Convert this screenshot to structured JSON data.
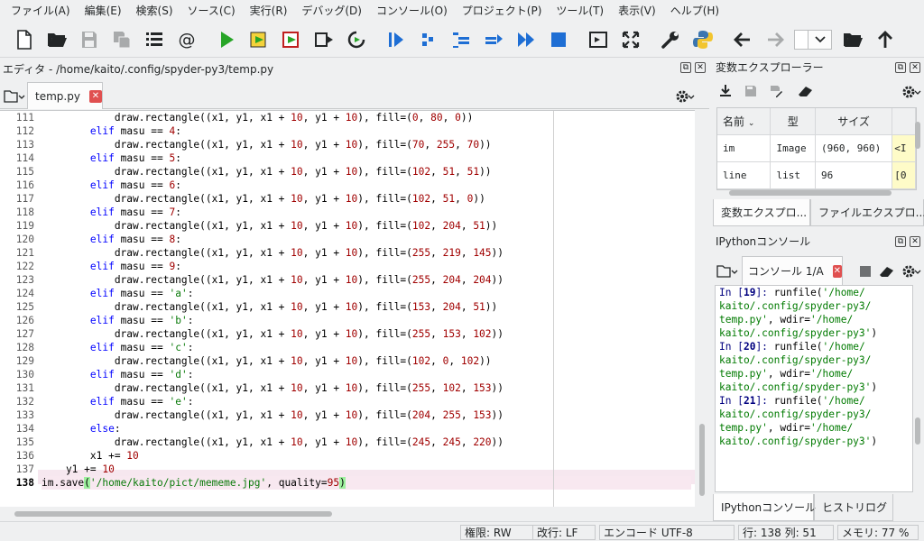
{
  "menubar": {
    "items": [
      "ファイル(A)",
      "編集(E)",
      "検索(S)",
      "ソース(C)",
      "実行(R)",
      "デバッグ(D)",
      "コンソール(O)",
      "プロジェクト(P)",
      "ツール(T)",
      "表示(V)",
      "ヘルプ(H)"
    ]
  },
  "toolbar": {
    "icons": [
      "new-file-icon",
      "open-folder-icon",
      "save-icon",
      "save-all-icon",
      "list-icon",
      "at-icon",
      "run-icon",
      "run-cell-icon",
      "run-cell-advance-icon",
      "run-selection-icon",
      "rerun-icon",
      "debug-icon",
      "step-icon",
      "step-into-icon",
      "step-return-icon",
      "continue-icon",
      "stop-icon",
      "maximize-pane-icon",
      "fullscreen-icon",
      "tools-wrench-icon",
      "python-path-icon",
      "back-arrow-icon",
      "forward-arrow-icon",
      "working-dir-combo",
      "browse-folder-icon",
      "parent-dir-arrow-icon"
    ]
  },
  "editor": {
    "title": "エディタ - /home/kaito/.config/spyder-py3/temp.py",
    "tab_label": "temp.py",
    "tab_close": "✕",
    "lines": [
      {
        "n": "111",
        "segs": [
          {
            "t": "            draw.rectangle((x1, y1, x1 + "
          },
          {
            "t": "10",
            "c": "num"
          },
          {
            "t": ", y1 + "
          },
          {
            "t": "10",
            "c": "num"
          },
          {
            "t": "), fill=("
          },
          {
            "t": "0",
            "c": "num"
          },
          {
            "t": ", "
          },
          {
            "t": "80",
            "c": "num"
          },
          {
            "t": ", "
          },
          {
            "t": "0",
            "c": "num"
          },
          {
            "t": "))"
          }
        ]
      },
      {
        "n": "112",
        "segs": [
          {
            "t": "        "
          },
          {
            "t": "elif",
            "c": "kw"
          },
          {
            "t": " masu == "
          },
          {
            "t": "4",
            "c": "num"
          },
          {
            "t": ":"
          }
        ]
      },
      {
        "n": "113",
        "segs": [
          {
            "t": "            draw.rectangle((x1, y1, x1 + "
          },
          {
            "t": "10",
            "c": "num"
          },
          {
            "t": ", y1 + "
          },
          {
            "t": "10",
            "c": "num"
          },
          {
            "t": "), fill=("
          },
          {
            "t": "70",
            "c": "num"
          },
          {
            "t": ", "
          },
          {
            "t": "255",
            "c": "num"
          },
          {
            "t": ", "
          },
          {
            "t": "70",
            "c": "num"
          },
          {
            "t": "))"
          }
        ]
      },
      {
        "n": "114",
        "segs": [
          {
            "t": "        "
          },
          {
            "t": "elif",
            "c": "kw"
          },
          {
            "t": " masu == "
          },
          {
            "t": "5",
            "c": "num"
          },
          {
            "t": ":"
          }
        ]
      },
      {
        "n": "115",
        "segs": [
          {
            "t": "            draw.rectangle((x1, y1, x1 + "
          },
          {
            "t": "10",
            "c": "num"
          },
          {
            "t": ", y1 + "
          },
          {
            "t": "10",
            "c": "num"
          },
          {
            "t": "), fill=("
          },
          {
            "t": "102",
            "c": "num"
          },
          {
            "t": ", "
          },
          {
            "t": "51",
            "c": "num"
          },
          {
            "t": ", "
          },
          {
            "t": "51",
            "c": "num"
          },
          {
            "t": "))"
          }
        ]
      },
      {
        "n": "116",
        "segs": [
          {
            "t": "        "
          },
          {
            "t": "elif",
            "c": "kw"
          },
          {
            "t": " masu == "
          },
          {
            "t": "6",
            "c": "num"
          },
          {
            "t": ":"
          }
        ]
      },
      {
        "n": "117",
        "segs": [
          {
            "t": "            draw.rectangle((x1, y1, x1 + "
          },
          {
            "t": "10",
            "c": "num"
          },
          {
            "t": ", y1 + "
          },
          {
            "t": "10",
            "c": "num"
          },
          {
            "t": "), fill=("
          },
          {
            "t": "102",
            "c": "num"
          },
          {
            "t": ", "
          },
          {
            "t": "51",
            "c": "num"
          },
          {
            "t": ", "
          },
          {
            "t": "0",
            "c": "num"
          },
          {
            "t": "))"
          }
        ]
      },
      {
        "n": "118",
        "segs": [
          {
            "t": "        "
          },
          {
            "t": "elif",
            "c": "kw"
          },
          {
            "t": " masu == "
          },
          {
            "t": "7",
            "c": "num"
          },
          {
            "t": ":"
          }
        ]
      },
      {
        "n": "119",
        "segs": [
          {
            "t": "            draw.rectangle((x1, y1, x1 + "
          },
          {
            "t": "10",
            "c": "num"
          },
          {
            "t": ", y1 + "
          },
          {
            "t": "10",
            "c": "num"
          },
          {
            "t": "), fill=("
          },
          {
            "t": "102",
            "c": "num"
          },
          {
            "t": ", "
          },
          {
            "t": "204",
            "c": "num"
          },
          {
            "t": ", "
          },
          {
            "t": "51",
            "c": "num"
          },
          {
            "t": "))"
          }
        ]
      },
      {
        "n": "120",
        "segs": [
          {
            "t": "        "
          },
          {
            "t": "elif",
            "c": "kw"
          },
          {
            "t": " masu == "
          },
          {
            "t": "8",
            "c": "num"
          },
          {
            "t": ":"
          }
        ]
      },
      {
        "n": "121",
        "segs": [
          {
            "t": "            draw.rectangle((x1, y1, x1 + "
          },
          {
            "t": "10",
            "c": "num"
          },
          {
            "t": ", y1 + "
          },
          {
            "t": "10",
            "c": "num"
          },
          {
            "t": "), fill=("
          },
          {
            "t": "255",
            "c": "num"
          },
          {
            "t": ", "
          },
          {
            "t": "219",
            "c": "num"
          },
          {
            "t": ", "
          },
          {
            "t": "145",
            "c": "num"
          },
          {
            "t": "))"
          }
        ]
      },
      {
        "n": "122",
        "segs": [
          {
            "t": "        "
          },
          {
            "t": "elif",
            "c": "kw"
          },
          {
            "t": " masu == "
          },
          {
            "t": "9",
            "c": "num"
          },
          {
            "t": ":"
          }
        ]
      },
      {
        "n": "123",
        "segs": [
          {
            "t": "            draw.rectangle((x1, y1, x1 + "
          },
          {
            "t": "10",
            "c": "num"
          },
          {
            "t": ", y1 + "
          },
          {
            "t": "10",
            "c": "num"
          },
          {
            "t": "), fill=("
          },
          {
            "t": "255",
            "c": "num"
          },
          {
            "t": ", "
          },
          {
            "t": "204",
            "c": "num"
          },
          {
            "t": ", "
          },
          {
            "t": "204",
            "c": "num"
          },
          {
            "t": "))"
          }
        ]
      },
      {
        "n": "124",
        "segs": [
          {
            "t": "        "
          },
          {
            "t": "elif",
            "c": "kw"
          },
          {
            "t": " masu == "
          },
          {
            "t": "'a'",
            "c": "str"
          },
          {
            "t": ":"
          }
        ]
      },
      {
        "n": "125",
        "segs": [
          {
            "t": "            draw.rectangle((x1, y1, x1 + "
          },
          {
            "t": "10",
            "c": "num"
          },
          {
            "t": ", y1 + "
          },
          {
            "t": "10",
            "c": "num"
          },
          {
            "t": "), fill=("
          },
          {
            "t": "153",
            "c": "num"
          },
          {
            "t": ", "
          },
          {
            "t": "204",
            "c": "num"
          },
          {
            "t": ", "
          },
          {
            "t": "51",
            "c": "num"
          },
          {
            "t": "))"
          }
        ]
      },
      {
        "n": "126",
        "segs": [
          {
            "t": "        "
          },
          {
            "t": "elif",
            "c": "kw"
          },
          {
            "t": " masu == "
          },
          {
            "t": "'b'",
            "c": "str"
          },
          {
            "t": ":"
          }
        ]
      },
      {
        "n": "127",
        "segs": [
          {
            "t": "            draw.rectangle((x1, y1, x1 + "
          },
          {
            "t": "10",
            "c": "num"
          },
          {
            "t": ", y1 + "
          },
          {
            "t": "10",
            "c": "num"
          },
          {
            "t": "), fill=("
          },
          {
            "t": "255",
            "c": "num"
          },
          {
            "t": ", "
          },
          {
            "t": "153",
            "c": "num"
          },
          {
            "t": ", "
          },
          {
            "t": "102",
            "c": "num"
          },
          {
            "t": "))"
          }
        ]
      },
      {
        "n": "128",
        "segs": [
          {
            "t": "        "
          },
          {
            "t": "elif",
            "c": "kw"
          },
          {
            "t": " masu == "
          },
          {
            "t": "'c'",
            "c": "str"
          },
          {
            "t": ":"
          }
        ]
      },
      {
        "n": "129",
        "segs": [
          {
            "t": "            draw.rectangle((x1, y1, x1 + "
          },
          {
            "t": "10",
            "c": "num"
          },
          {
            "t": ", y1 + "
          },
          {
            "t": "10",
            "c": "num"
          },
          {
            "t": "), fill=("
          },
          {
            "t": "102",
            "c": "num"
          },
          {
            "t": ", "
          },
          {
            "t": "0",
            "c": "num"
          },
          {
            "t": ", "
          },
          {
            "t": "102",
            "c": "num"
          },
          {
            "t": "))"
          }
        ]
      },
      {
        "n": "130",
        "segs": [
          {
            "t": "        "
          },
          {
            "t": "elif",
            "c": "kw"
          },
          {
            "t": " masu == "
          },
          {
            "t": "'d'",
            "c": "str"
          },
          {
            "t": ":"
          }
        ]
      },
      {
        "n": "131",
        "segs": [
          {
            "t": "            draw.rectangle((x1, y1, x1 + "
          },
          {
            "t": "10",
            "c": "num"
          },
          {
            "t": ", y1 + "
          },
          {
            "t": "10",
            "c": "num"
          },
          {
            "t": "), fill=("
          },
          {
            "t": "255",
            "c": "num"
          },
          {
            "t": ", "
          },
          {
            "t": "102",
            "c": "num"
          },
          {
            "t": ", "
          },
          {
            "t": "153",
            "c": "num"
          },
          {
            "t": "))"
          }
        ]
      },
      {
        "n": "132",
        "segs": [
          {
            "t": "        "
          },
          {
            "t": "elif",
            "c": "kw"
          },
          {
            "t": " masu == "
          },
          {
            "t": "'e'",
            "c": "str"
          },
          {
            "t": ":"
          }
        ]
      },
      {
        "n": "133",
        "segs": [
          {
            "t": "            draw.rectangle((x1, y1, x1 + "
          },
          {
            "t": "10",
            "c": "num"
          },
          {
            "t": ", y1 + "
          },
          {
            "t": "10",
            "c": "num"
          },
          {
            "t": "), fill=("
          },
          {
            "t": "204",
            "c": "num"
          },
          {
            "t": ", "
          },
          {
            "t": "255",
            "c": "num"
          },
          {
            "t": ", "
          },
          {
            "t": "153",
            "c": "num"
          },
          {
            "t": "))"
          }
        ]
      },
      {
        "n": "134",
        "segs": [
          {
            "t": "        "
          },
          {
            "t": "else",
            "c": "kw"
          },
          {
            "t": ":"
          }
        ]
      },
      {
        "n": "135",
        "segs": [
          {
            "t": "            draw.rectangle((x1, y1, x1 + "
          },
          {
            "t": "10",
            "c": "num"
          },
          {
            "t": ", y1 + "
          },
          {
            "t": "10",
            "c": "num"
          },
          {
            "t": "), fill=("
          },
          {
            "t": "245",
            "c": "num"
          },
          {
            "t": ", "
          },
          {
            "t": "245",
            "c": "num"
          },
          {
            "t": ", "
          },
          {
            "t": "220",
            "c": "num"
          },
          {
            "t": "))"
          }
        ]
      },
      {
        "n": "136",
        "segs": [
          {
            "t": "        x1 += "
          },
          {
            "t": "10",
            "c": "num"
          }
        ]
      },
      {
        "n": "137",
        "segs": [
          {
            "t": "    y1 += "
          },
          {
            "t": "10",
            "c": "num"
          }
        ]
      },
      {
        "n": "138",
        "current": true,
        "segs": [
          {
            "t": "im.save"
          },
          {
            "t": "(",
            "c": "brace"
          },
          {
            "t": "'/home/kaito/pict/mememe.jpg'",
            "c": "str"
          },
          {
            "t": ", quality="
          },
          {
            "t": "95",
            "c": "num"
          },
          {
            "t": ")",
            "c": "brace"
          }
        ]
      }
    ]
  },
  "variable_explorer": {
    "title": "変数エクスプローラー",
    "columns": [
      "名前",
      "型",
      "サイズ",
      ""
    ],
    "rows": [
      {
        "name": "im",
        "type": "Image",
        "size": "(960, 960)",
        "value": "<I"
      },
      {
        "name": "line",
        "type": "list",
        "size": "96",
        "value": "[0"
      }
    ],
    "tabs": [
      "変数エクスプロ...",
      "ファイルエクスプロ..."
    ]
  },
  "ipython": {
    "title": "IPythonコンソール",
    "tab_label": "コンソール 1/A",
    "tab_close": "✕",
    "lines": [
      {
        "t": "",
        "kind": "blank"
      },
      {
        "t": "In [19]: runfile('/home/",
        "kind": "in",
        "num": "19",
        "rest": "runfile(",
        "s": "'/home/"
      },
      {
        "t": "kaito/.config/spyder-py3/",
        "kind": "cont"
      },
      {
        "t": "temp.py', wdir='/home/",
        "kind": "cont"
      },
      {
        "t": "kaito/.config/spyder-py3')",
        "kind": "cont"
      },
      {
        "t": "",
        "kind": "blank"
      },
      {
        "t": "In [20]: runfile('/home/",
        "kind": "in",
        "num": "20",
        "rest": "runfile(",
        "s": "'/home/"
      },
      {
        "t": "kaito/.config/spyder-py3/",
        "kind": "cont"
      },
      {
        "t": "temp.py', wdir='/home/",
        "kind": "cont"
      },
      {
        "t": "kaito/.config/spyder-py3')",
        "kind": "cont"
      },
      {
        "t": "",
        "kind": "blank"
      },
      {
        "t": "In [21]: runfile('/home/",
        "kind": "in",
        "num": "21",
        "rest": "runfile(",
        "s": "'/home/"
      },
      {
        "t": "kaito/.config/spyder-py3/",
        "kind": "cont"
      },
      {
        "t": "temp.py', wdir='/home/",
        "kind": "cont"
      },
      {
        "t": "kaito/.config/spyder-py3')",
        "kind": "cont"
      }
    ],
    "tabs": [
      "IPythonコンソール",
      "ヒストリログ"
    ]
  },
  "statusbar": {
    "permissions": "権限: RW",
    "eol": "改行: LF",
    "encoding": "エンコード  UTF-8",
    "cursor": "行: 138   列: 51",
    "memory": "メモリ: 77 %"
  },
  "colors": {
    "keyword": "#0000ff",
    "number": "#a00000",
    "string": "#0a7a0a",
    "run_green": "#27a527",
    "debug_blue": "#1e6ed4",
    "close_red": "#e05050"
  }
}
